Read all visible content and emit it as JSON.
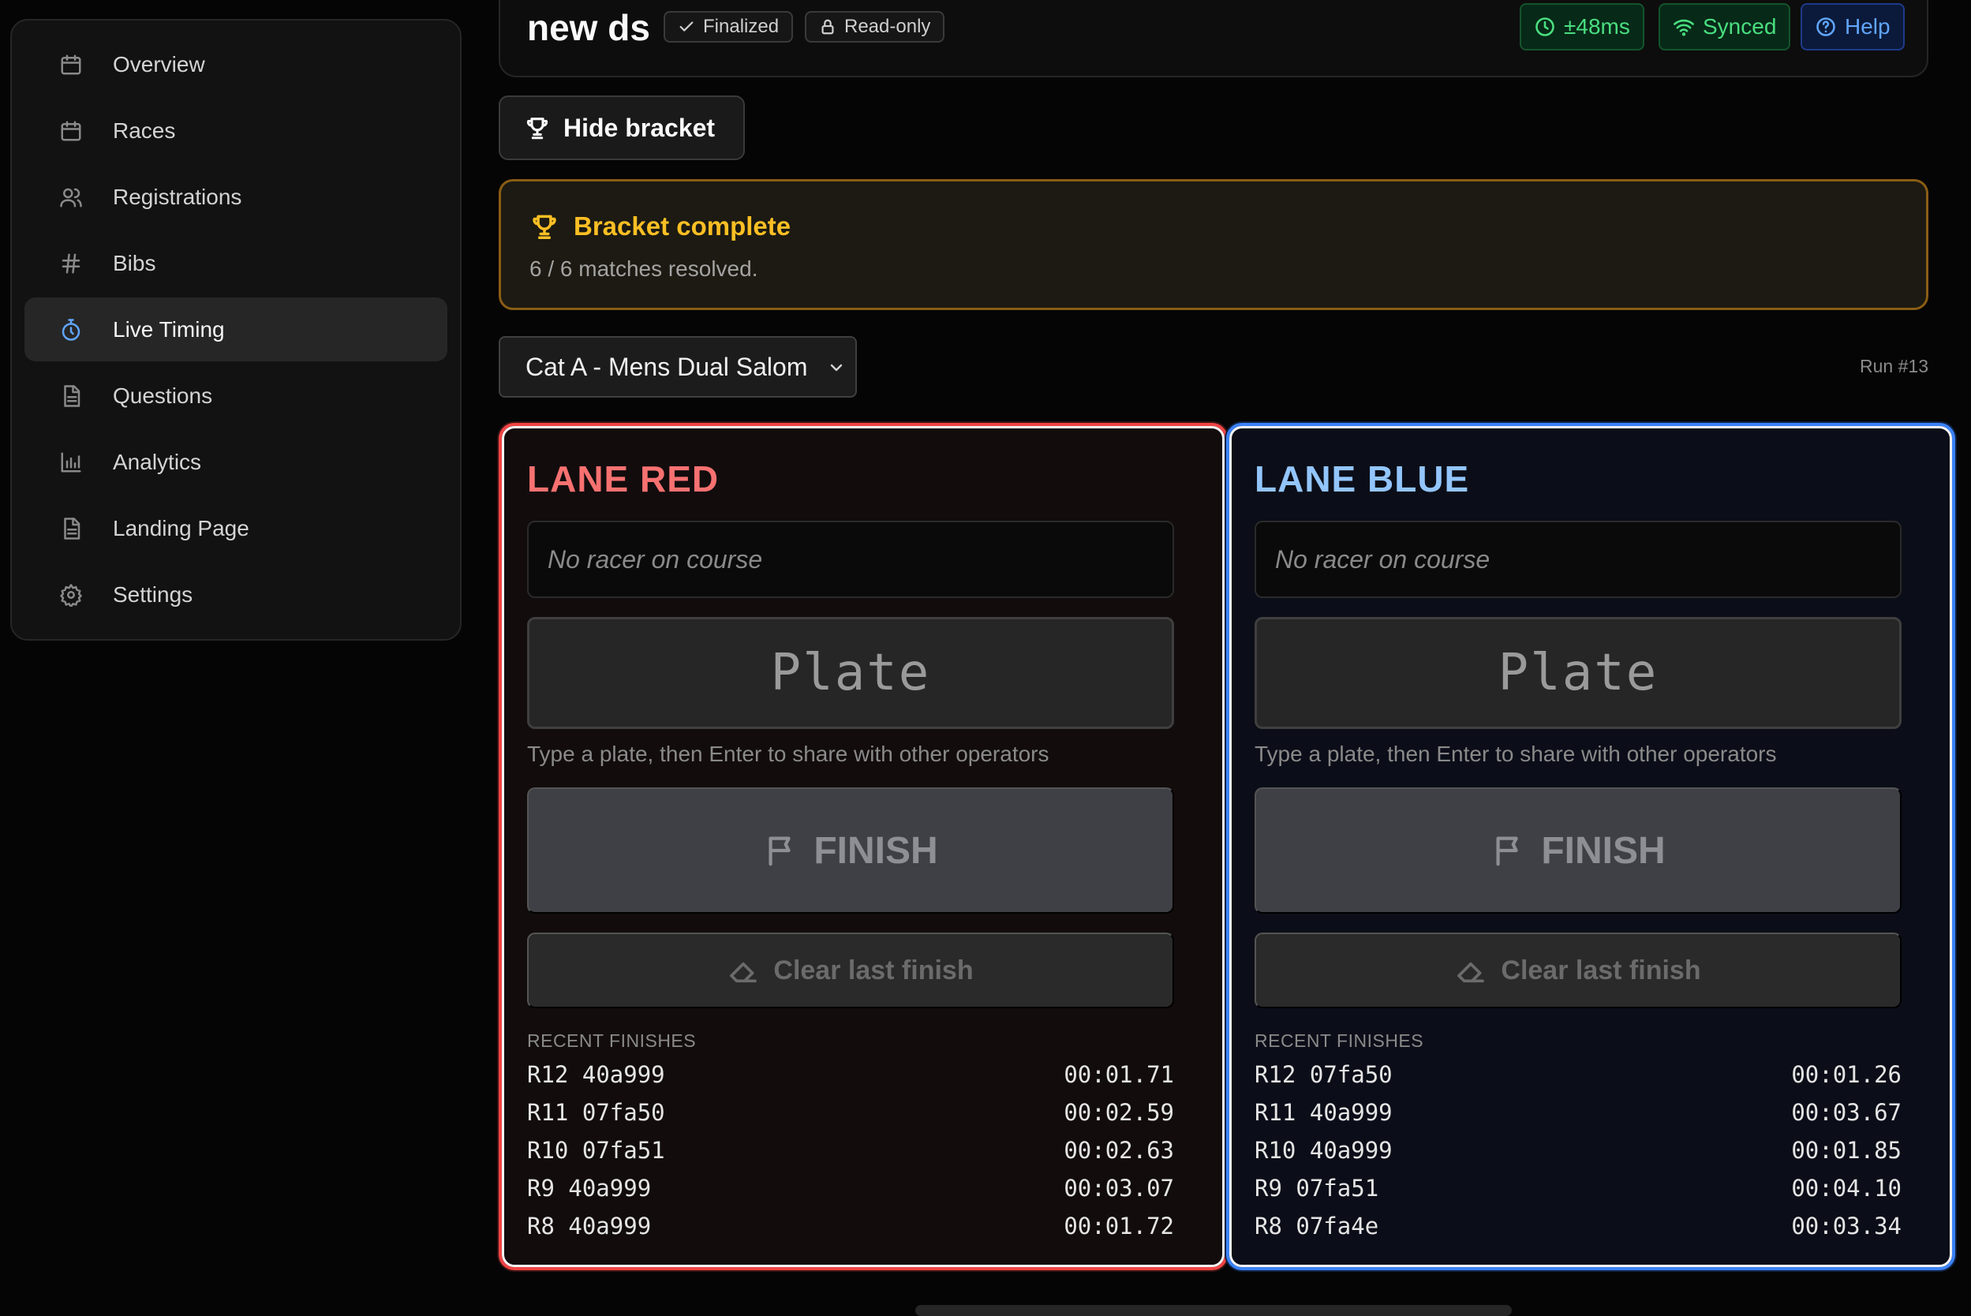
{
  "sidebar": {
    "items": [
      {
        "label": "Overview",
        "icon": "calendar-icon"
      },
      {
        "label": "Races",
        "icon": "calendar-icon"
      },
      {
        "label": "Registrations",
        "icon": "users-icon"
      },
      {
        "label": "Bibs",
        "icon": "hash-icon"
      },
      {
        "label": "Live Timing",
        "icon": "stopwatch-icon",
        "active": true
      },
      {
        "label": "Questions",
        "icon": "document-icon"
      },
      {
        "label": "Analytics",
        "icon": "bar-chart-icon"
      },
      {
        "label": "Landing Page",
        "icon": "document-icon"
      },
      {
        "label": "Settings",
        "icon": "gear-icon"
      }
    ]
  },
  "header": {
    "title": "new ds",
    "finalized_label": "Finalized",
    "readonly_label": "Read-only",
    "latency_label": "±48ms",
    "synced_label": "Synced",
    "help_label": "Help"
  },
  "bracket": {
    "toggle_label": "Hide bracket",
    "title": "Bracket complete",
    "summary": "6 / 6 matches resolved."
  },
  "category": {
    "selected": "Cat A - Mens Dual Salom",
    "run_label": "Run #13"
  },
  "lanes": {
    "red": {
      "title": "LANE RED",
      "racer_status": "No racer on course",
      "plate_placeholder": "Plate",
      "plate_hint": "Type a plate, then Enter to share with other operators",
      "finish_label": "FINISH",
      "clear_label": "Clear last finish",
      "recent_heading": "RECENT FINISHES",
      "recent": [
        {
          "run": "R12",
          "plate": "40a999",
          "time": "00:01.71"
        },
        {
          "run": "R11",
          "plate": "07fa50",
          "time": "00:02.59"
        },
        {
          "run": "R10",
          "plate": "07fa51",
          "time": "00:02.63"
        },
        {
          "run": "R9",
          "plate": "40a999",
          "time": "00:03.07"
        },
        {
          "run": "R8",
          "plate": "40a999",
          "time": "00:01.72"
        }
      ]
    },
    "blue": {
      "title": "LANE BLUE",
      "racer_status": "No racer on course",
      "plate_placeholder": "Plate",
      "plate_hint": "Type a plate, then Enter to share with other operators",
      "finish_label": "FINISH",
      "clear_label": "Clear last finish",
      "recent_heading": "RECENT FINISHES",
      "recent": [
        {
          "run": "R12",
          "plate": "07fa50",
          "time": "00:01.26"
        },
        {
          "run": "R11",
          "plate": "40a999",
          "time": "00:03.67"
        },
        {
          "run": "R10",
          "plate": "40a999",
          "time": "00:01.85"
        },
        {
          "run": "R9",
          "plate": "07fa51",
          "time": "00:04.10"
        },
        {
          "run": "R8",
          "plate": "07fa4e",
          "time": "00:03.34"
        }
      ]
    }
  },
  "colors": {
    "accent_blue": "#60a5fa",
    "lane_red": "#ef4444",
    "lane_blue": "#3b82f6",
    "bracket_gold": "#fbbf24",
    "synced_green": "#4ade80"
  }
}
